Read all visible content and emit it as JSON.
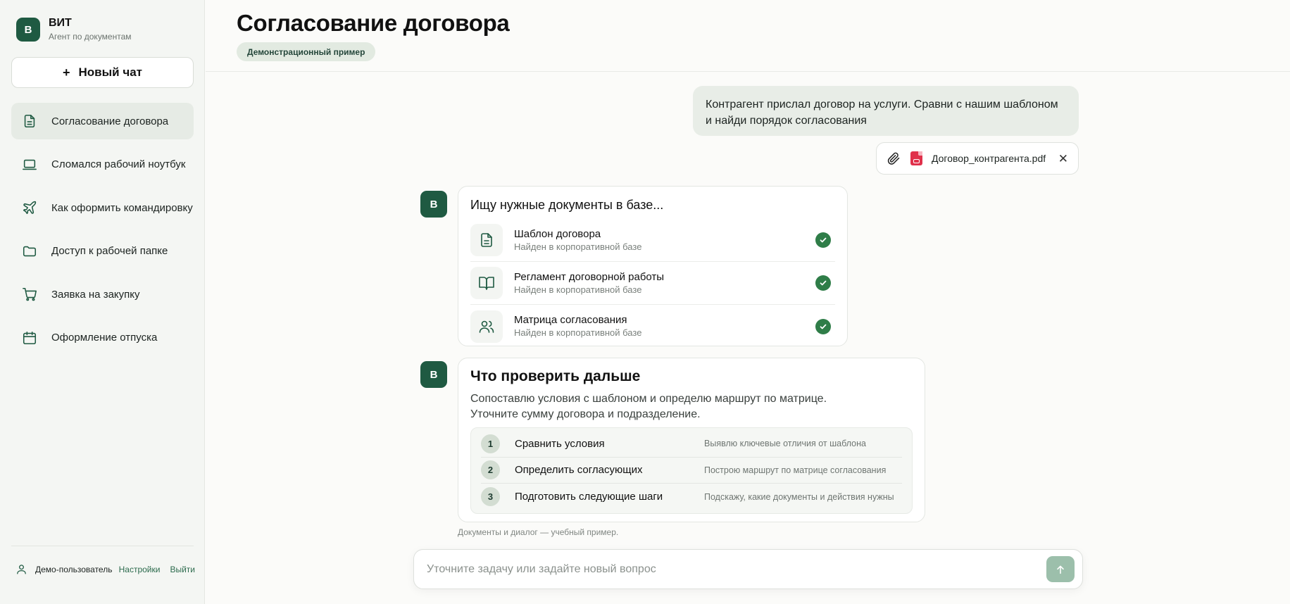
{
  "brand": {
    "logo": "В",
    "name": "ВИТ",
    "subtitle": "Агент по документам"
  },
  "sidebar": {
    "new_chat_label": "Новый чат",
    "items": [
      {
        "label": "Согласование договора",
        "icon": "document-icon",
        "active": true
      },
      {
        "label": "Сломался рабочий ноутбук",
        "icon": "laptop-icon"
      },
      {
        "label": "Как оформить командировку",
        "icon": "plane-icon"
      },
      {
        "label": "Доступ к рабочей папке",
        "icon": "folder-icon"
      },
      {
        "label": "Заявка на закупку",
        "icon": "cart-icon"
      },
      {
        "label": "Оформление отпуска",
        "icon": "calendar-icon"
      }
    ],
    "user": {
      "name": "Демо-пользователь",
      "settings_label": "Настройки",
      "logout_label": "Выйти"
    }
  },
  "header": {
    "title": "Согласование договора",
    "badge": "Демонстрационный пример"
  },
  "chat": {
    "user_message": "Контрагент прислал договор на услуги. Сравни с нашим шаблоном и найди порядок согласования",
    "attachment": {
      "filename": "Договор_контрагента.pdf"
    },
    "bot_avatar": "В",
    "search": {
      "heading": "Ищу нужные документы в базе...",
      "docs": [
        {
          "title": "Шаблон договора",
          "status": "Найден в корпоративной базе",
          "icon": "document-icon"
        },
        {
          "title": "Регламент договорной работы",
          "status": "Найден в корпоративной базе",
          "icon": "book-icon"
        },
        {
          "title": "Матрица согласования",
          "status": "Найден в корпоративной базе",
          "icon": "users-icon"
        }
      ]
    },
    "next": {
      "title": "Что проверить дальше",
      "desc_line1": "Сопоставлю условия с шаблоном и определю маршрут по матрице.",
      "desc_line2": "Уточните сумму договора и подразделение.",
      "steps": [
        {
          "num": "1",
          "title": "Сравнить условия",
          "desc": "Выявлю ключевые отличия от шаблона"
        },
        {
          "num": "2",
          "title": "Определить согласующих",
          "desc": "Построю маршрут по матрице согласования"
        },
        {
          "num": "3",
          "title": "Подготовить следующие шаги",
          "desc": "Подскажу, какие документы и действия нужны"
        }
      ]
    },
    "footnote": "Документы и диалог — учебный пример."
  },
  "composer": {
    "placeholder": "Уточните задачу или задайте новый вопрос"
  },
  "colors": {
    "accent": "#1f5a42",
    "check": "#2f7d48",
    "pdf": "#e0314b",
    "send": "#9cbfab"
  }
}
